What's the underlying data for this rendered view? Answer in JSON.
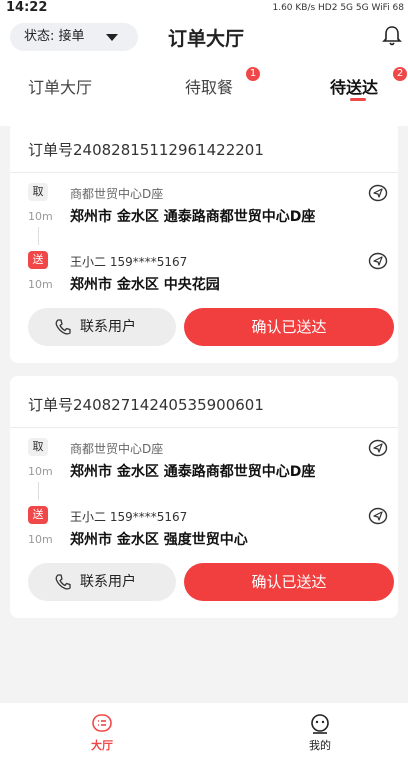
{
  "status_bar": {
    "time": "14:22",
    "indicators": "1.60 KB/s  HD2  5G  5G  WiFi  68"
  },
  "header": {
    "status_label": "状态: 接单",
    "title": "订单大厅",
    "tabs": [
      {
        "label": "订单大厅",
        "badge": ""
      },
      {
        "label": "待取餐",
        "badge": "1"
      },
      {
        "label": "待送达",
        "badge": "2"
      }
    ],
    "active_tab": "待送达"
  },
  "orders": [
    {
      "order_no": "订单号2408281511296142​2201",
      "pickup": {
        "tag": "取",
        "name": "商都世贸中心D座",
        "distance": "10m",
        "address": "郑州市 金水区 通泰路商都世贸中心D座"
      },
      "delivery": {
        "tag": "送",
        "contact": "王小二 159****5167",
        "distance": "10m",
        "address": "郑州市 金水区 中央花园"
      },
      "contact_button": "联系用户",
      "confirm_button": "确认已送达"
    },
    {
      "order_no": "订单号24082714240535900601",
      "pickup": {
        "tag": "取",
        "name": "商都世贸中心D座",
        "distance": "10m",
        "address": "郑州市 金水区 通泰路商都世贸中心D座"
      },
      "delivery": {
        "tag": "送",
        "contact": "王小二 159****5167",
        "distance": "10m",
        "address": "郑州市 金水区 强度世贸中心"
      },
      "contact_button": "联系用户",
      "confirm_button": "确认已送达"
    }
  ],
  "bottom_nav": [
    {
      "label": "大厅",
      "icon": "hall-icon",
      "active": true
    },
    {
      "label": "我的",
      "icon": "profile-icon",
      "active": false
    }
  ],
  "colors": {
    "accent": "#f13f3f",
    "background": "#f3f3f3"
  }
}
